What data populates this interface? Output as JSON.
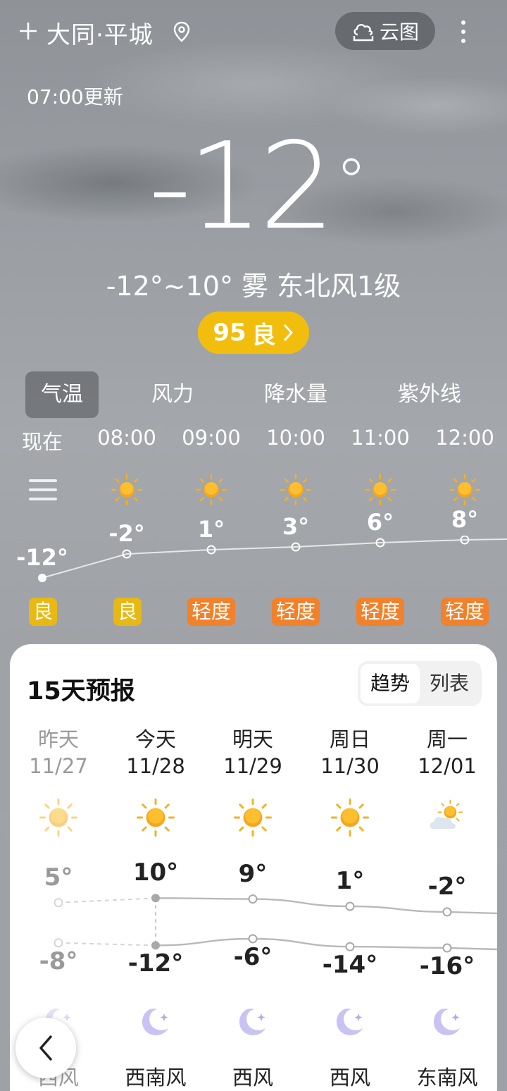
{
  "header": {
    "location": "大同·平城",
    "cloud_map_label": "云图",
    "icons": {
      "add": "plus-icon",
      "location": "map-pin-icon",
      "cloud_map": "cloud-map-icon",
      "more": "more-vertical-icon"
    }
  },
  "current": {
    "update_time": "07:00更新",
    "temperature": "-12",
    "temp_unit": "°",
    "summary": "-12°~10° 雾 东北风1级",
    "aqi_value": "95",
    "aqi_label": "良",
    "aqi_color": "#f2be0d"
  },
  "tabs": [
    {
      "label": "气温",
      "active": true
    },
    {
      "label": "风力",
      "active": false
    },
    {
      "label": "降水量",
      "active": false
    },
    {
      "label": "紫外线",
      "active": false
    }
  ],
  "hourly": [
    {
      "time": "现在",
      "icon": "menu-lines-icon",
      "temp": "-12°",
      "temp_value": -12,
      "aqi": "良",
      "aqi_color": "#e8b814"
    },
    {
      "time": "08:00",
      "icon": "sun-icon",
      "temp": "-2°",
      "temp_value": -2,
      "aqi": "良",
      "aqi_color": "#e8b814"
    },
    {
      "time": "09:00",
      "icon": "sun-icon",
      "temp": "1°",
      "temp_value": 1,
      "aqi": "轻度",
      "aqi_color": "#f2812b"
    },
    {
      "time": "10:00",
      "icon": "sun-icon",
      "temp": "3°",
      "temp_value": 3,
      "aqi": "轻度",
      "aqi_color": "#f2812b"
    },
    {
      "time": "11:00",
      "icon": "sun-icon",
      "temp": "6°",
      "temp_value": 6,
      "aqi": "轻度",
      "aqi_color": "#f2812b"
    },
    {
      "time": "12:00",
      "icon": "sun-icon",
      "temp": "8°",
      "temp_value": 8,
      "aqi": "轻度",
      "aqi_color": "#f2812b"
    }
  ],
  "forecast": {
    "title": "15天预报",
    "view_options": [
      {
        "label": "趋势",
        "active": true
      },
      {
        "label": "列表",
        "active": false
      }
    ],
    "days": [
      {
        "name": "昨天",
        "date": "11/27",
        "day_icon": "sun-icon",
        "high": "5°",
        "high_value": 5,
        "low": "-8°",
        "low_value": -8,
        "night_icon": "moon-icon",
        "wind": "西风",
        "past": true
      },
      {
        "name": "今天",
        "date": "11/28",
        "day_icon": "sun-icon",
        "high": "10°",
        "high_value": 10,
        "low": "-12°",
        "low_value": -12,
        "night_icon": "moon-icon",
        "wind": "西南风",
        "past": false
      },
      {
        "name": "明天",
        "date": "11/29",
        "day_icon": "sun-icon",
        "high": "9°",
        "high_value": 9,
        "low": "-6°",
        "low_value": -6,
        "night_icon": "moon-icon",
        "wind": "西风",
        "past": false
      },
      {
        "name": "周日",
        "date": "11/30",
        "day_icon": "sun-icon",
        "high": "1°",
        "high_value": 1,
        "low": "-14°",
        "low_value": -14,
        "night_icon": "moon-icon",
        "wind": "西风",
        "past": false
      },
      {
        "name": "周一",
        "date": "12/01",
        "day_icon": "partly-cloudy-icon",
        "high": "-2°",
        "high_value": -2,
        "low": "-16°",
        "low_value": -16,
        "night_icon": "moon-icon",
        "wind": "东南风",
        "past": false
      }
    ]
  },
  "nav": {
    "back_icon": "chevron-left-icon"
  }
}
